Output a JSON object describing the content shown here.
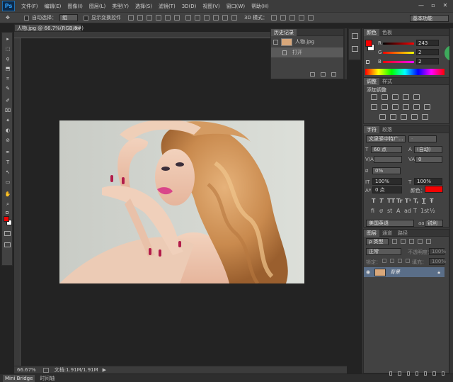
{
  "app": {
    "logo": "Ps"
  },
  "menu": [
    "文件(F)",
    "编辑(E)",
    "图像(I)",
    "图层(L)",
    "类型(Y)",
    "选择(S)",
    "滤镜(T)",
    "3D(D)",
    "视图(V)",
    "窗口(W)",
    "帮助(H)"
  ],
  "window_controls": {
    "minimize": "—",
    "restore": "▫",
    "close": "✕"
  },
  "options": {
    "auto_select_label": "自动选择：",
    "auto_select_value": "组",
    "transform_label": "显示变换控件",
    "mode_3d": "3D 模式：",
    "workspace": "基本功能"
  },
  "document": {
    "tab_title": "人物.jpg @ 66.7%(RGB/8#)",
    "close": "×",
    "zoom": "66.67%",
    "doc_info": "文档:1.91M/1.91M"
  },
  "tools": [
    "▸",
    "⬚",
    "ϙ",
    "⬒",
    "⌗",
    "✎",
    "✐",
    "⌧",
    "✦",
    "◐",
    "⊘",
    "✒",
    "T",
    "↖",
    "▭",
    "✋",
    "⌕"
  ],
  "history": {
    "tab": "历史记录",
    "snapshot": "人物.jpg",
    "step": "打开"
  },
  "color_panel": {
    "tabs": [
      "颜色",
      "色板"
    ],
    "r_label": "R",
    "g_label": "G",
    "b_label": "B",
    "r": "243",
    "g": "2",
    "b": "2",
    "fg": "#f30202",
    "bg": "#ffffff"
  },
  "adjustments": {
    "tabs": [
      "调整",
      "样式"
    ],
    "title": "添加调整"
  },
  "character": {
    "tabs": [
      "字符",
      "段落"
    ],
    "font": "文泉驿中特广...",
    "style": "-",
    "size": "60 点",
    "leading": "(自动)",
    "kerning": "",
    "tracking": "0",
    "scale_pct": "0%",
    "vscale": "100%",
    "hscale": "100%",
    "baseline": "0 点",
    "color_label": "颜色：",
    "text_color": "#f30202",
    "glyphs": [
      "T",
      "T",
      "TT",
      "Tr",
      "T¹",
      "T,",
      "T",
      "Ŧ"
    ],
    "glyphs2": [
      "fi",
      "ơ",
      "st",
      "A",
      "ad",
      "T",
      "1st",
      "½"
    ],
    "language": "美国英语",
    "aa": "锐利"
  },
  "layers": {
    "tabs": [
      "图层",
      "通道",
      "路径"
    ],
    "kind": "ρ 类型",
    "blend": "正常",
    "opacity_label": "不透明度：",
    "opacity": "100%",
    "lock_label": "锁定：",
    "fill_label": "填充：",
    "fill": "100%",
    "layer_name": "背景"
  },
  "bottom_tabs": [
    "Mini Bridge",
    "时间轴"
  ]
}
